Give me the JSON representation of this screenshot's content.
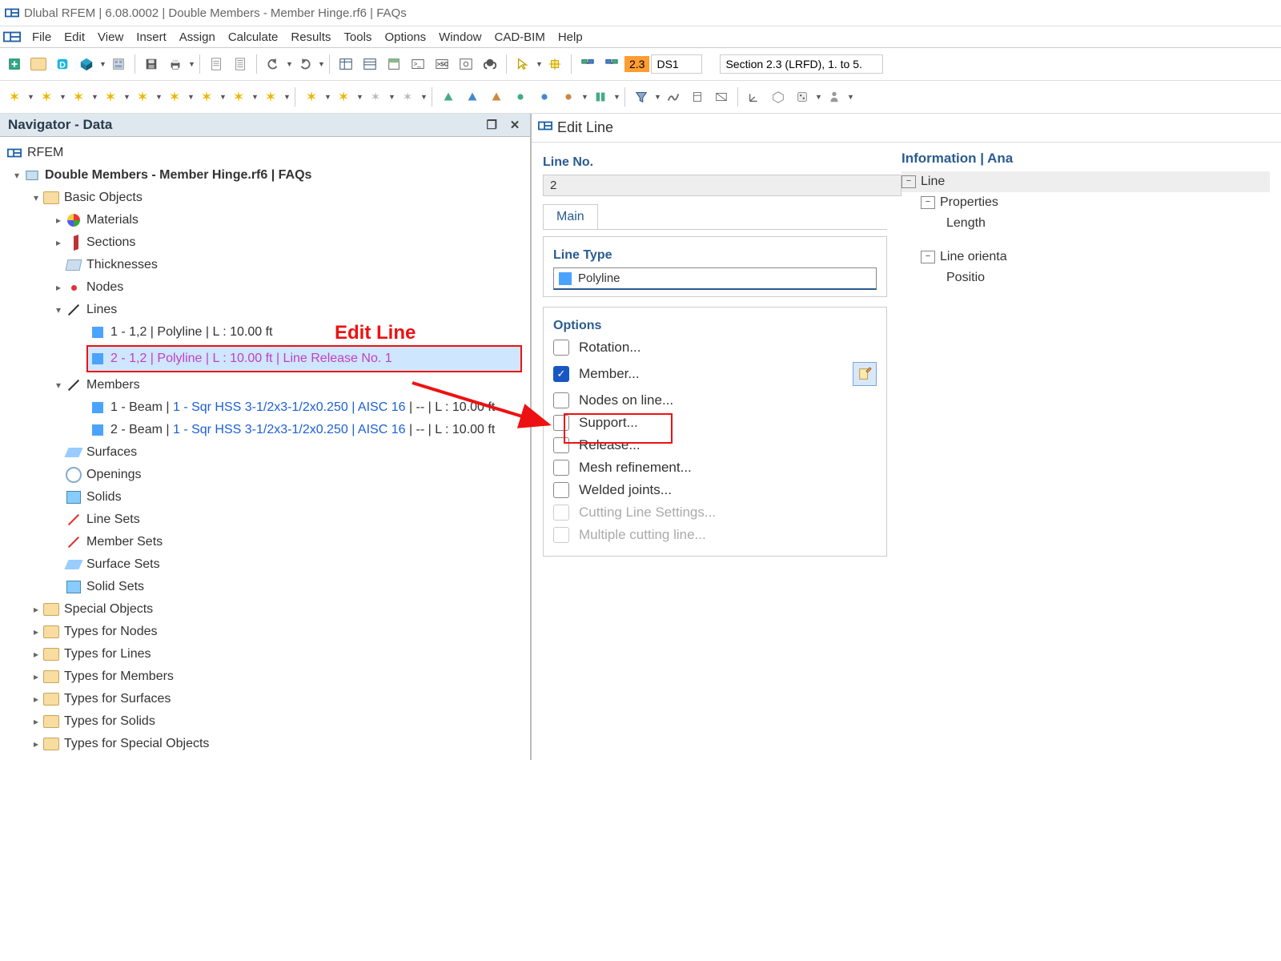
{
  "window_title": "Dlubal RFEM | 6.08.0002 | Double Members - Member Hinge.rf6 | FAQs",
  "menus": [
    "File",
    "Edit",
    "View",
    "Insert",
    "Assign",
    "Calculate",
    "Results",
    "Tools",
    "Options",
    "Window",
    "CAD-BIM",
    "Help"
  ],
  "toolbar_tag": "2.3",
  "toolbar_ds_field": "DS1",
  "toolbar_section_field": "Section 2.3 (LRFD), 1. to 5.",
  "navigator": {
    "title": "Navigator - Data",
    "root": "RFEM",
    "project": "Double Members - Member Hinge.rf6 | FAQs",
    "basic_objects": "Basic Objects",
    "materials": "Materials",
    "sections": "Sections",
    "thicknesses": "Thicknesses",
    "nodes": "Nodes",
    "lines": "Lines",
    "line1": "1 - 1,2 | Polyline | L : 10.00 ft",
    "line2": "2 - 1,2 | Polyline | L : 10.00 ft | Line Release No. 1",
    "members": "Members",
    "member1_pre": "1 - Beam | ",
    "member1_link": "1 - Sqr HSS 3-1/2x3-1/2x0.250 | AISC 16",
    "member1_post": " | -- | L : 10.00 ft",
    "member2_pre": "2 - Beam | ",
    "member2_link": "1 - Sqr HSS 3-1/2x3-1/2x0.250 | AISC 16",
    "member2_post": " | -- | L : 10.00 ft",
    "surfaces": "Surfaces",
    "openings": "Openings",
    "solids": "Solids",
    "line_sets": "Line Sets",
    "member_sets": "Member Sets",
    "surface_sets": "Surface Sets",
    "solid_sets": "Solid Sets",
    "special_objects": "Special Objects",
    "types_for_nodes": "Types for Nodes",
    "types_for_lines": "Types for Lines",
    "types_for_members": "Types for Members",
    "types_for_surfaces": "Types for Surfaces",
    "types_for_solids": "Types for Solids",
    "types_for_special_objects": "Types for Special Objects"
  },
  "callout_label": "Edit Line",
  "dialog": {
    "title": "Edit Line",
    "line_no_label": "Line No.",
    "line_no_value": "2",
    "tab_main": "Main",
    "line_type_label": "Line Type",
    "line_type_value": "Polyline",
    "options_label": "Options",
    "options": [
      {
        "label": "Rotation...",
        "checked": false,
        "disabled": false
      },
      {
        "label": "Member...",
        "checked": true,
        "disabled": false
      },
      {
        "label": "Nodes on line...",
        "checked": false,
        "disabled": false
      },
      {
        "label": "Support...",
        "checked": false,
        "disabled": false
      },
      {
        "label": "Release...",
        "checked": false,
        "disabled": false
      },
      {
        "label": "Mesh refinement...",
        "checked": false,
        "disabled": false
      },
      {
        "label": "Welded joints...",
        "checked": false,
        "disabled": false
      },
      {
        "label": "Cutting Line Settings...",
        "checked": false,
        "disabled": true
      },
      {
        "label": "Multiple cutting line...",
        "checked": false,
        "disabled": true
      }
    ],
    "info_header": "Information | Ana",
    "info_line": "Line",
    "info_props": "Properties",
    "info_length": "Length",
    "info_orient": "Line orienta",
    "info_positio": "Positio"
  }
}
